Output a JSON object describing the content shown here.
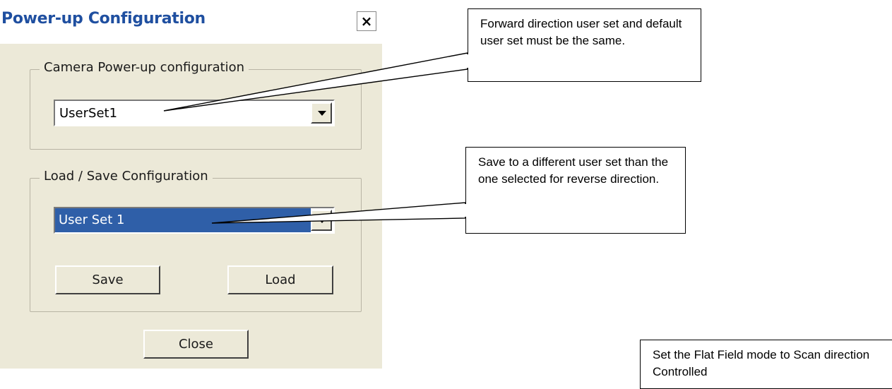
{
  "dialog": {
    "title": "Power-up Configuration",
    "close_glyph": "×",
    "camera_group": {
      "legend": "Camera Power-up configuration",
      "selected_value": "UserSet1"
    },
    "loadsave_group": {
      "legend": "Load / Save Configuration",
      "selected_value": "User Set 1",
      "save_label": "Save",
      "load_label": "Load"
    },
    "close_button_label": "Close"
  },
  "callouts": {
    "forward": "Forward direction user set and default user set must be the same.",
    "save_different": "Save to a different user set than the one selected for reverse direction.",
    "flat_field": "Set the Flat Field mode to Scan direction Controlled"
  },
  "colors": {
    "title_blue": "#1f4fa0",
    "selection_blue": "#2f5fa8",
    "dialog_bg": "#ece9d8"
  }
}
